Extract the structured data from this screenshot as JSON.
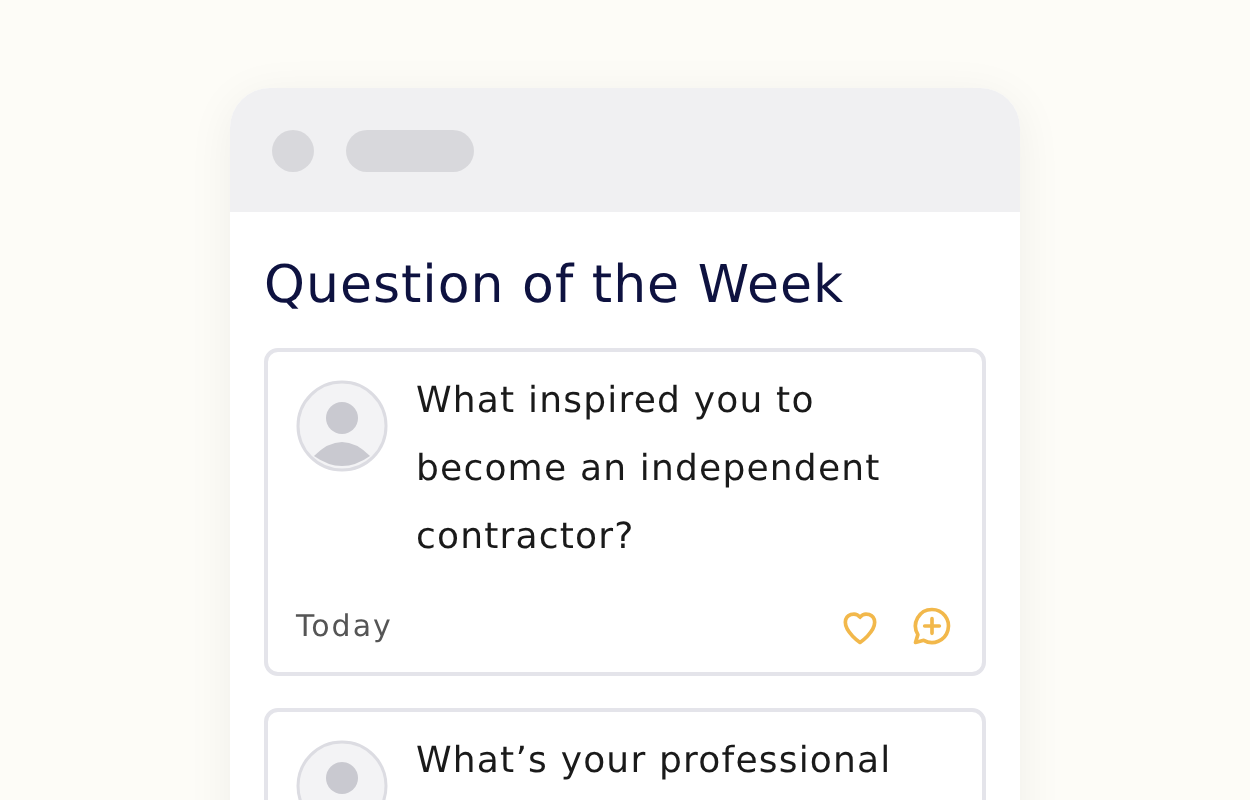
{
  "title": "Question of the Week",
  "questions": [
    {
      "text": "What inspired you to become an independent contractor?",
      "date": "Today",
      "liked": false
    },
    {
      "text": "What’s your professional"
    }
  ]
}
